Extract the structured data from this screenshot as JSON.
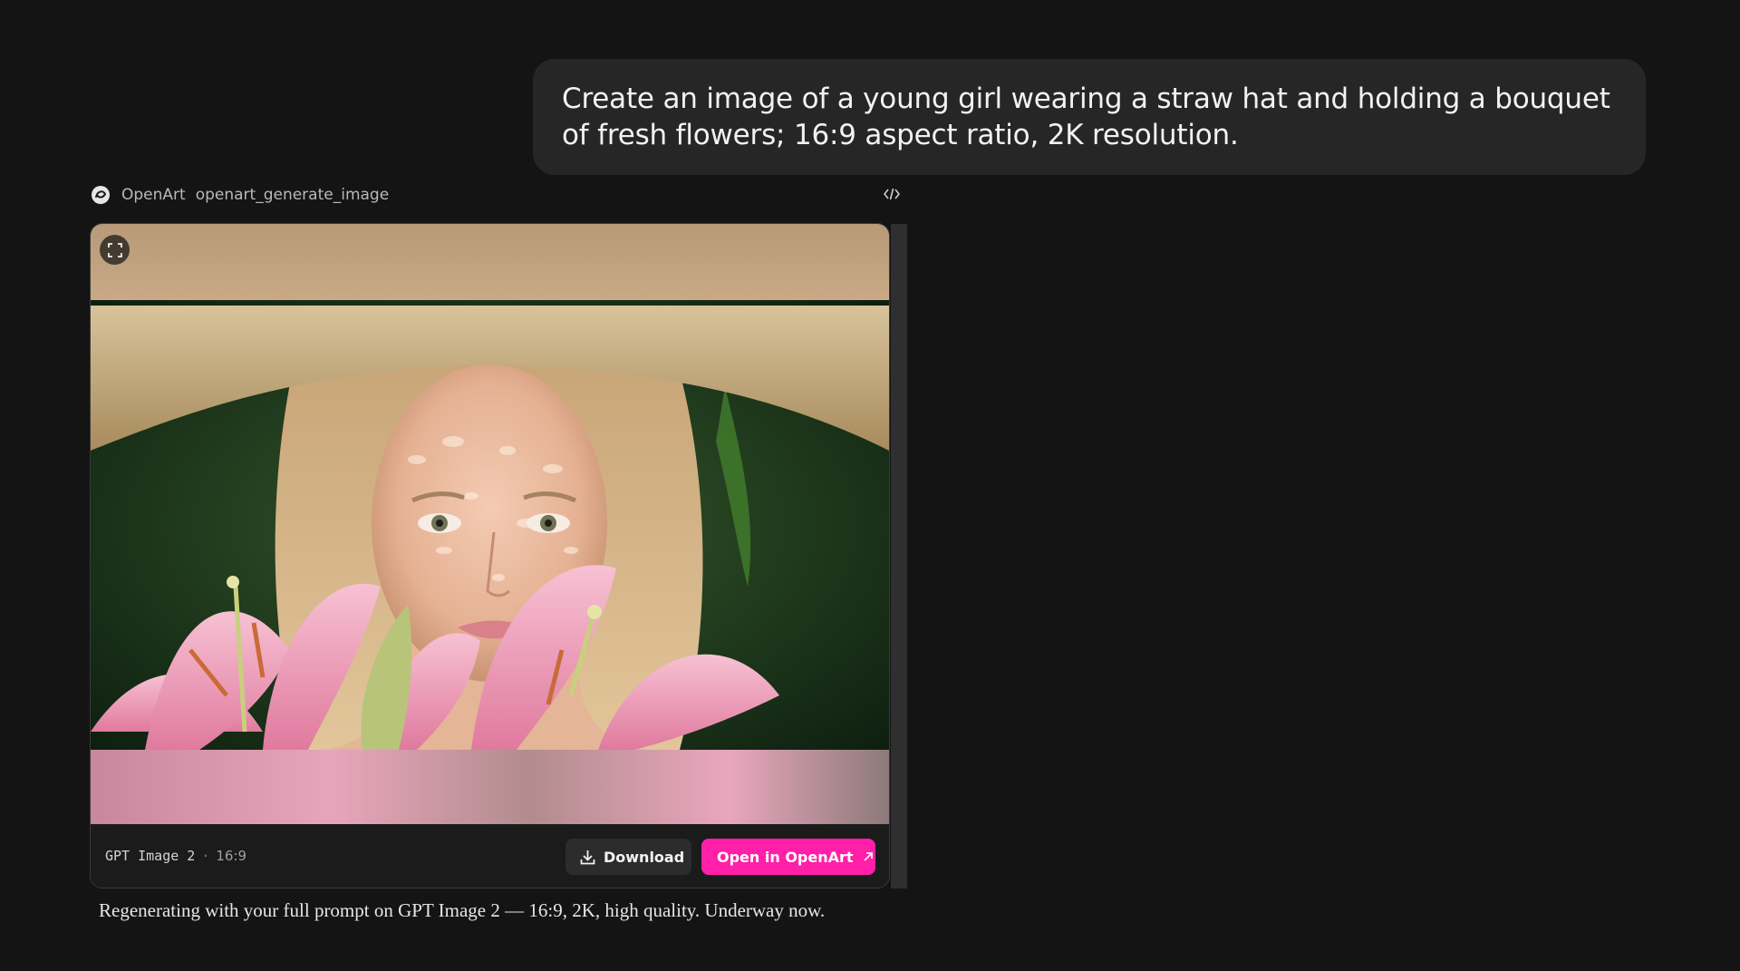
{
  "prompt": {
    "text": "Create an image of a young girl wearing a straw hat and holding a bouquet of fresh flowers; 16:9 aspect ratio, 2K resolution."
  },
  "tool": {
    "provider": "OpenArt",
    "function": "openart_generate_image",
    "icon": "openart-logo-icon",
    "code_icon": "code-icon"
  },
  "image_card": {
    "expand_icon": "expand-icon",
    "model": "GPT Image 2",
    "separator": "·",
    "aspect_ratio": "16:9",
    "download_label": "Download",
    "download_icon": "download-icon",
    "open_label": "Open in OpenArt",
    "open_icon": "external-link-icon"
  },
  "status": {
    "text": "Regenerating with your full prompt on GPT Image 2 — 16:9, 2K, high quality. Underway now."
  },
  "colors": {
    "background": "#141415",
    "bubble": "#262627",
    "accent": "#ff1fa8",
    "card_footer": "#1b1b1c"
  }
}
